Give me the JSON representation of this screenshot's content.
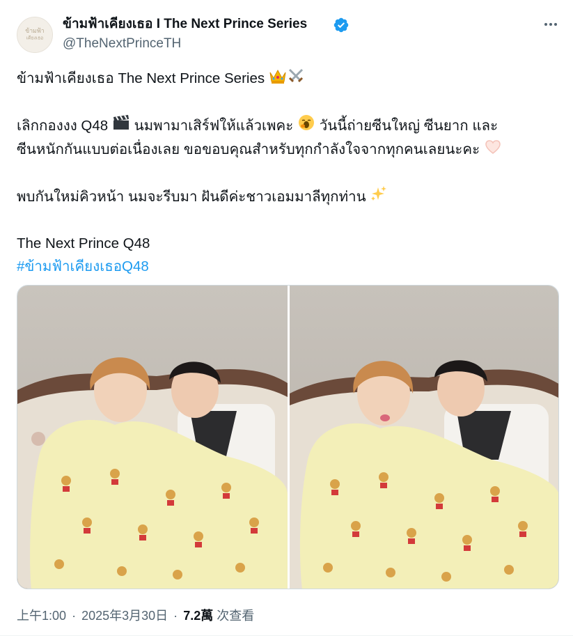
{
  "author": {
    "display_name": "ข้ามฟ้าเคียงเธอ I The Next Prince Series",
    "handle": "@TheNextPrinceTH",
    "avatar_text": "ข้ามฟ้า เคียงเธอ",
    "verified": true
  },
  "tweet": {
    "lines": [
      "ข้ามฟ้าเคียงเธอ The Next Prince Series",
      "",
      "เลิกกองงง Q48",
      "ซีนหนักกันแบบต่อเนื่องเลย ขอขอบคุณสำหรับทุกกำลังใจจากทุกคนเลยนะคะ",
      "",
      "พบกันใหม่คิวหน้า นมจะรีบมา ฝันดีค่ะชาวเอมมาลีทุกท่าน",
      "",
      "The Next Prince Q48"
    ],
    "line3_part2": "นมพามาเสิร์ฟให้แล้วเพคะ",
    "line3_part3": "วันนี้ถ่ายซีนใหญ่ ซีนยาก และ",
    "hashtag": "#ข้ามฟ้าเคียงเธอQ48",
    "emoji": {
      "crown": "crown-emoji",
      "swords": "crossed-swords-emoji",
      "clapper": "clapper-board-emoji",
      "yawn": "yawning-face-emoji",
      "heart_hands": "heart-hands-emoji",
      "sparkles": "sparkles-emoji"
    }
  },
  "media": {
    "photos": [
      {
        "alt": "photo-1"
      },
      {
        "alt": "photo-2"
      }
    ]
  },
  "meta": {
    "time": "上午1:00",
    "date": "2025年3月30日",
    "views_count": "7.2萬",
    "views_label": "次查看",
    "separator": "·"
  },
  "colors": {
    "text": "#0f1419",
    "secondary": "#536471",
    "link": "#1d9bf0",
    "verified": "#1d9bf0",
    "blanket": "#f3efb8"
  }
}
